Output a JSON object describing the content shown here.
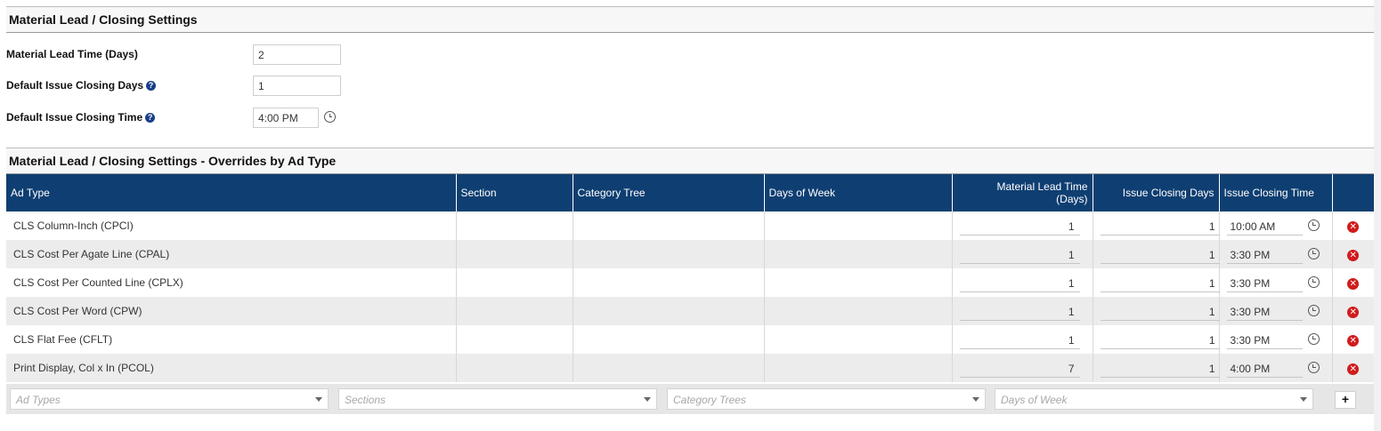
{
  "settings": {
    "title": "Material Lead / Closing Settings",
    "lead_time_label": "Material Lead Time (Days)",
    "lead_time_value": "2",
    "closing_days_label": "Default Issue Closing Days",
    "closing_days_value": "1",
    "closing_time_label": "Default Issue Closing Time",
    "closing_time_value": "4:00 PM",
    "help_glyph": "?"
  },
  "overrides": {
    "title": "Material Lead / Closing Settings - Overrides by Ad Type",
    "columns": {
      "ad_type": "Ad Type",
      "section": "Section",
      "category_tree": "Category Tree",
      "days_of_week": "Days of Week",
      "lead_time_line1": "Material Lead Time",
      "lead_time_line2": "(Days)",
      "closing_days": "Issue Closing Days",
      "closing_time": "Issue Closing Time"
    },
    "rows": [
      {
        "ad_type": "CLS Column-Inch (CPCI)",
        "section": "",
        "category_tree": "",
        "days_of_week": "",
        "lead_time": "1",
        "closing_days": "1",
        "closing_time": "10:00 AM"
      },
      {
        "ad_type": "CLS Cost Per Agate Line (CPAL)",
        "section": "",
        "category_tree": "",
        "days_of_week": "",
        "lead_time": "1",
        "closing_days": "1",
        "closing_time": "3:30 PM"
      },
      {
        "ad_type": "CLS Cost Per Counted Line (CPLX)",
        "section": "",
        "category_tree": "",
        "days_of_week": "",
        "lead_time": "1",
        "closing_days": "1",
        "closing_time": "3:30 PM"
      },
      {
        "ad_type": "CLS Cost Per Word (CPW)",
        "section": "",
        "category_tree": "",
        "days_of_week": "",
        "lead_time": "1",
        "closing_days": "1",
        "closing_time": "3:30 PM"
      },
      {
        "ad_type": "CLS Flat Fee (CFLT)",
        "section": "",
        "category_tree": "",
        "days_of_week": "",
        "lead_time": "1",
        "closing_days": "1",
        "closing_time": "3:30 PM"
      },
      {
        "ad_type": "Print Display, Col x In (PCOL)",
        "section": "",
        "category_tree": "",
        "days_of_week": "",
        "lead_time": "7",
        "closing_days": "1",
        "closing_time": "4:00 PM"
      }
    ],
    "delete_glyph": "✕",
    "add_row": {
      "ad_types_placeholder": "Ad Types",
      "sections_placeholder": "Sections",
      "category_trees_placeholder": "Category Trees",
      "days_of_week_placeholder": "Days of Week",
      "add_label": "+"
    }
  },
  "colors": {
    "header_bg": "#0f3f72",
    "delete_red": "#d01c1c",
    "help_blue": "#1a3f8a"
  }
}
